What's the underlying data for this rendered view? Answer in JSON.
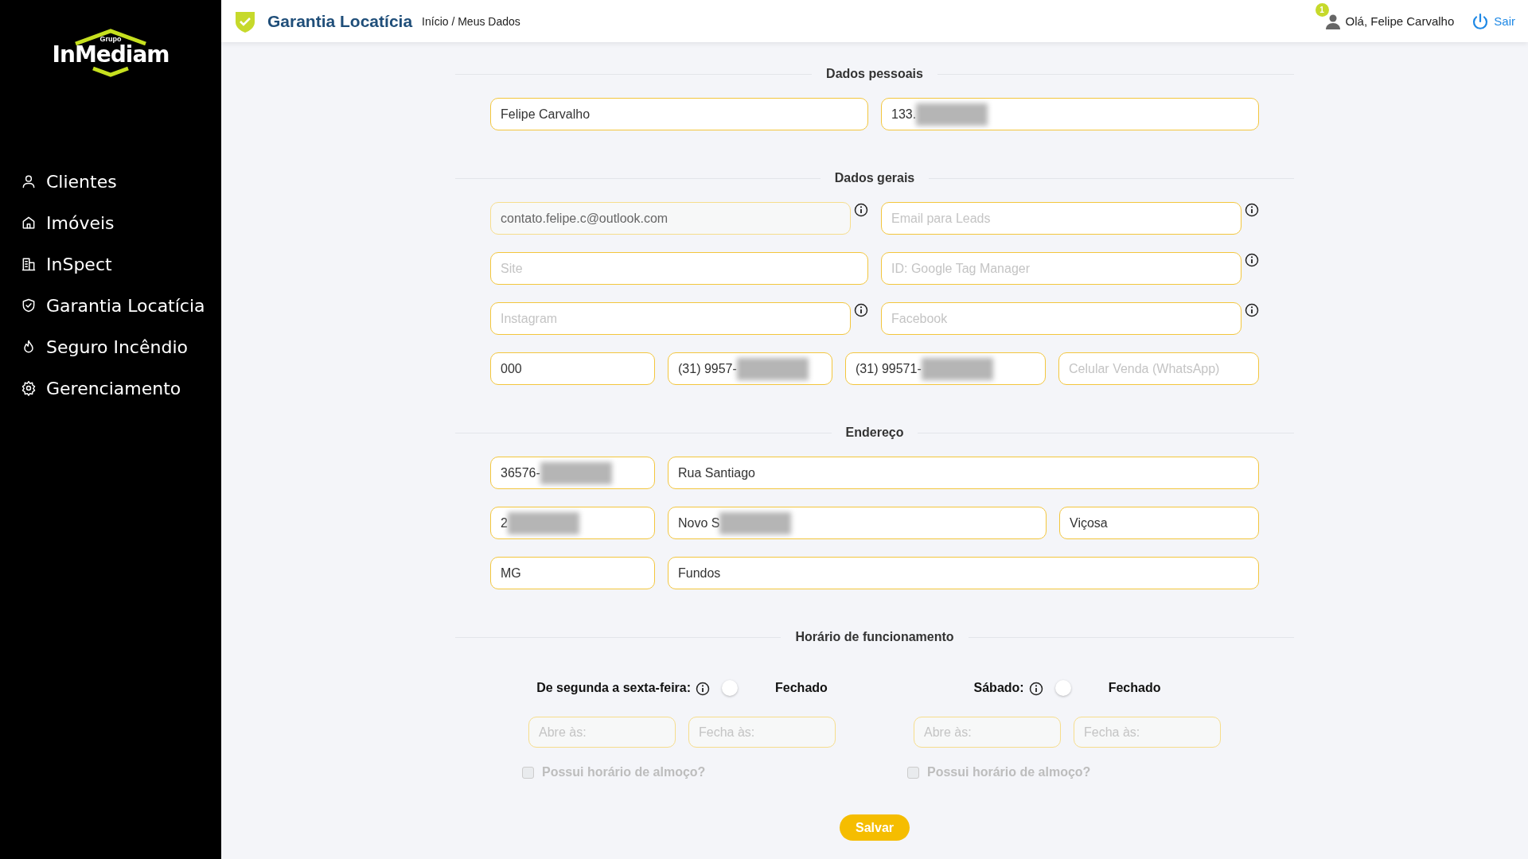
{
  "sidebar": {
    "logo": {
      "small": "Grupo",
      "name": "InMediam"
    },
    "items": [
      {
        "label": "Clientes",
        "kind": "user"
      },
      {
        "label": "Imóveis",
        "kind": "home"
      },
      {
        "label": "InSpect",
        "kind": "building"
      },
      {
        "label": "Garantia Locatícia",
        "kind": "shield"
      },
      {
        "label": "Seguro Incêndio",
        "kind": "flame"
      },
      {
        "label": "Gerenciamento",
        "kind": "gear"
      }
    ]
  },
  "header": {
    "title": "Garantia Locatícia",
    "breadcrumb": "Início / Meus Dados",
    "notification_count": "1",
    "greeting": "Olá, Felipe Carvalho",
    "logout": "Sair"
  },
  "sections": [
    {
      "title": "Dados pessoais",
      "rows": [
        {
          "kind": "half",
          "fields": [
            {
              "value": "Felipe Carvalho",
              "info": false,
              "disabled": false,
              "redacted": false
            },
            {
              "value": "133.",
              "info": false,
              "disabled": false,
              "redacted": true
            }
          ]
        }
      ]
    },
    {
      "title": "Dados gerais",
      "rows": [
        {
          "kind": "half",
          "fields": [
            {
              "value": "contato.felipe.c@outlook.com",
              "info": true,
              "disabled": true,
              "redacted": false
            },
            {
              "placeholder": "Email para Leads",
              "info": true,
              "disabled": false,
              "redacted": false
            }
          ]
        },
        {
          "kind": "half",
          "fields": [
            {
              "placeholder": "Site",
              "info": false,
              "disabled": false,
              "redacted": false
            },
            {
              "placeholder": "ID: Google Tag Manager",
              "info": true,
              "disabled": false,
              "redacted": false
            }
          ]
        },
        {
          "kind": "half",
          "fields": [
            {
              "placeholder": "Instagram",
              "info": true,
              "disabled": false,
              "redacted": false
            },
            {
              "placeholder": "Facebook",
              "info": true,
              "disabled": false,
              "redacted": false
            }
          ]
        },
        {
          "kind": "phones",
          "fields": [
            {
              "value": "000",
              "info": false,
              "disabled": false,
              "redacted": false
            },
            {
              "value": "(31) 9957-",
              "info": false,
              "disabled": false,
              "redacted": true
            },
            {
              "value": "(31) 99571-",
              "info": false,
              "disabled": false,
              "redacted": true
            },
            {
              "placeholder": "Celular Venda (WhatsApp)",
              "info": false,
              "disabled": false,
              "redacted": false
            }
          ]
        }
      ]
    },
    {
      "title": "Endereço",
      "rows": [
        {
          "kind": "narrow-wide",
          "fields": [
            {
              "value": "36576-",
              "info": false,
              "disabled": false,
              "redacted": true
            },
            {
              "value": "Rua Santiago",
              "info": false,
              "disabled": false,
              "redacted": false
            }
          ]
        },
        {
          "kind": "narrow-mid-small",
          "fields": [
            {
              "value": "2",
              "info": false,
              "disabled": false,
              "redacted": true
            },
            {
              "value": "Novo S",
              "info": false,
              "disabled": false,
              "redacted": true
            },
            {
              "value": "Viçosa",
              "info": false,
              "disabled": false,
              "redacted": false
            }
          ]
        },
        {
          "kind": "narrow-wide",
          "fields": [
            {
              "value": "MG",
              "info": false,
              "disabled": false,
              "redacted": false
            },
            {
              "value": "Fundos",
              "info": false,
              "disabled": false,
              "redacted": false
            }
          ]
        }
      ]
    }
  ],
  "hours": {
    "title": "Horário de funcionamento",
    "days": [
      {
        "label": "De segunda a sexta-feira:",
        "on": false,
        "status": "Fechado",
        "fields": [
          {
            "placeholder": "Abre às:",
            "disabled": true
          },
          {
            "placeholder": "Fecha às:",
            "disabled": true
          }
        ],
        "lunch": {
          "label": "Possui horário de almoço?",
          "checked": false,
          "disabled": true
        }
      },
      {
        "label": "Sábado:",
        "on": false,
        "status": "Fechado",
        "fields": [
          {
            "placeholder": "Abre às:",
            "disabled": true
          },
          {
            "placeholder": "Fecha às:",
            "disabled": true
          }
        ],
        "lunch": {
          "label": "Possui horário de almoço?",
          "checked": false,
          "disabled": true
        }
      }
    ]
  },
  "save_button": "Salvar"
}
